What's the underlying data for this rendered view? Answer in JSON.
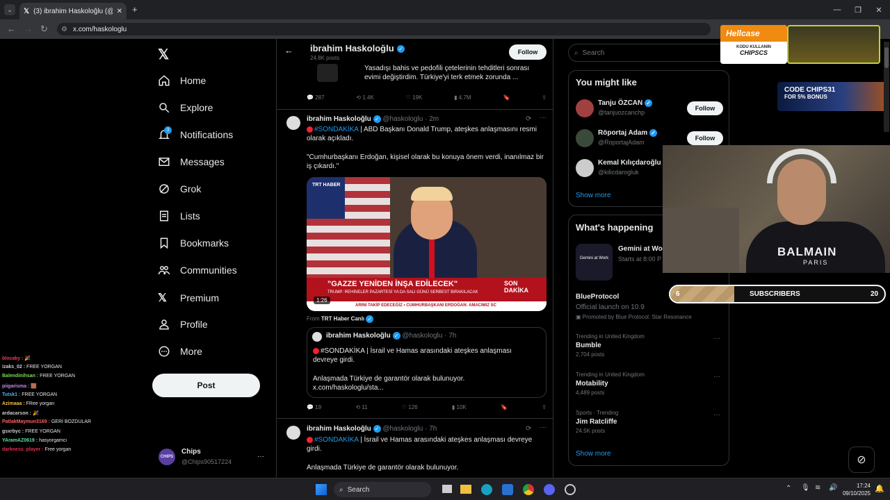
{
  "browser": {
    "tab_title": "(3) ibrahim Haskoloğlu (@hask",
    "url": "x.com/haskologlu"
  },
  "nav": {
    "items": [
      {
        "label": "Home",
        "icon": "home-icon"
      },
      {
        "label": "Explore",
        "icon": "search-icon"
      },
      {
        "label": "Notifications",
        "icon": "bell-icon",
        "badge": "3"
      },
      {
        "label": "Messages",
        "icon": "mail-icon"
      },
      {
        "label": "Grok",
        "icon": "grok-icon"
      },
      {
        "label": "Lists",
        "icon": "list-icon"
      },
      {
        "label": "Bookmarks",
        "icon": "bookmark-icon"
      },
      {
        "label": "Communities",
        "icon": "people-icon"
      },
      {
        "label": "Premium",
        "icon": "x-logo-icon"
      },
      {
        "label": "Profile",
        "icon": "person-icon"
      },
      {
        "label": "More",
        "icon": "more-circle-icon"
      }
    ],
    "post_label": "Post"
  },
  "account": {
    "name": "Chips",
    "handle": "@Chips90517224"
  },
  "profile_header": {
    "name": "ibrahim Haskoloğlu",
    "posts": "24.8K posts",
    "follow": "Follow"
  },
  "tweet0": {
    "text": "Yasadışı bahis ve pedofili çetelerinin tehditleri sonrası evimi değiştirdim. Türkiye'yi terk etmek zorunda ...",
    "replies": "287",
    "retweets": "1.4K",
    "likes": "19K",
    "views": "4.7M"
  },
  "tweet1": {
    "name": "ibrahim Haskoloğlu",
    "handle": "@haskologlu",
    "time": "· 2m",
    "hashtag": "#SONDAKİKA",
    "text1": " | ABD Başkanı Donald Trump, ateşkes anlaşmasını resmi olarak açıkladı.",
    "text2": "\"Cumhurbaşkanı Erdoğan, kişisel olarak bu konuya önem verdi, inanılmaz bir iş çıkardı.\"",
    "video_duration": "1:26",
    "from_label": "From",
    "from_source": "TRT Haber Canlı",
    "banner_main": "\"GAZZE YENİDEN İNŞA EDİLECEK\"",
    "banner_sub": "TRUMP: REHİNELER PAZARTESİ YA DA SALI GÜNÜ SERBEST BIRAKILACAK",
    "banner_tag": "SON DAKİKA",
    "ticker": "ARINI TAKİP EDECEĞİZ  •  CUMHURBAŞKANI ERDOĞAN: AMACIMIZ SC",
    "channel": "TRT HABER",
    "quote": {
      "name": "ibrahim Haskoloğlu",
      "handle": "@haskologlu",
      "time": "· 7h",
      "hashtag": "#SONDAKİKA",
      "text1": " | İsrail ve Hamas arasındaki ateşkes anlaşması devreye girdi.",
      "text2": "Anlaşmada Türkiye de garantör olarak bulunuyor.",
      "link": "x.com/haskologlu/sta..."
    },
    "replies": "19",
    "retweets": "11",
    "likes": "126",
    "views": "10K"
  },
  "tweet2": {
    "name": "ibrahim Haskoloğlu",
    "handle": "@haskologlu",
    "time": "· 7h",
    "hashtag": "#SONDAKİKA",
    "text1": " | İsrail ve Hamas arasındaki ateşkes anlaşması devreye girdi.",
    "text2": "Anlaşmada Türkiye de garantör olarak bulunuyor."
  },
  "search_placeholder": "Search",
  "you_might_like": {
    "title": "You might like",
    "people": [
      {
        "name": "Tanju ÖZCAN",
        "handle": "@tanjuozcanchp",
        "follow": "Follow"
      },
      {
        "name": "Röportaj Adam",
        "handle": "@RoportajAdam",
        "follow": "Follow"
      },
      {
        "name": "Kemal Kılıçdaroğlu",
        "handle": "@kilicdarogluk"
      }
    ],
    "show_more": "Show more"
  },
  "happening": {
    "title": "What's happening",
    "event": {
      "name": "Gemini at Wo",
      "time": "Starts at 8:00 P",
      "thumb": "Gemini at Work"
    },
    "promo": {
      "name": "BlueProtocol",
      "text": "Official launch on 10.9",
      "promoted": "Promoted by Blue Protocol: Star Resonance"
    },
    "trends": [
      {
        "ctx": "Trending in United Kingdom",
        "name": "Bumble",
        "posts": "2,704 posts"
      },
      {
        "ctx": "Trending in United Kingdom",
        "name": "Motability",
        "posts": "4,489 posts"
      },
      {
        "ctx": "Sports · Trending",
        "name": "Jim Ratcliffe",
        "posts": "24.5K posts"
      }
    ],
    "show_more": "Show more"
  },
  "overlay": {
    "hellcase": "Hellcase",
    "hell_sub1": "KODU KULLANIN",
    "hell_sub2": "CHIPSCS",
    "code_line1": "CODE CHIPS31",
    "code_line2": "FOR 5% BONUS",
    "sub_label": "SUBSCRIBERS",
    "sub_current": "6",
    "sub_goal": "20",
    "sub_progress": 0.3,
    "shirt_line1": "BALMAIN",
    "shirt_line2": "PARIS"
  },
  "chat": [
    {
      "user": "blocaky :",
      "msg": "🎉",
      "color": "#e0405a"
    },
    {
      "user": "izaks_02 :",
      "msg": "FREE YORGAN",
      "color": "#cccccc"
    },
    {
      "user": "Balendinihsan :",
      "msg": "FREE YORGAN",
      "color": "#7ed957"
    },
    {
      "user": "piigarisma :",
      "msg": "🟫",
      "color": "#c08af0"
    },
    {
      "user": "Tutsk1 :",
      "msg": "FREE YORGAN",
      "color": "#4fb0ff"
    },
    {
      "user": "Azimaaa :",
      "msg": "FRee yorgan",
      "color": "#f0c040"
    },
    {
      "user": "ardacarson :",
      "msg": "🎉",
      "color": "#cccccc"
    },
    {
      "user": "PatlakMaymun3169 :",
      "msg": "GERİ BOZDULAR",
      "color": "#ff6060"
    },
    {
      "user": "gsxrbyc :",
      "msg": "FREE YORGAN",
      "color": "#cccccc"
    },
    {
      "user": "YAramAZ0619 :",
      "msg": "hasyorgamcı",
      "color": "#60e0a0"
    },
    {
      "user": "darkness_player :",
      "msg": "Free yorgan",
      "color": "#e03050"
    }
  ],
  "taskbar": {
    "search": "Search",
    "time": "17:24",
    "date": "09/10/2025"
  }
}
